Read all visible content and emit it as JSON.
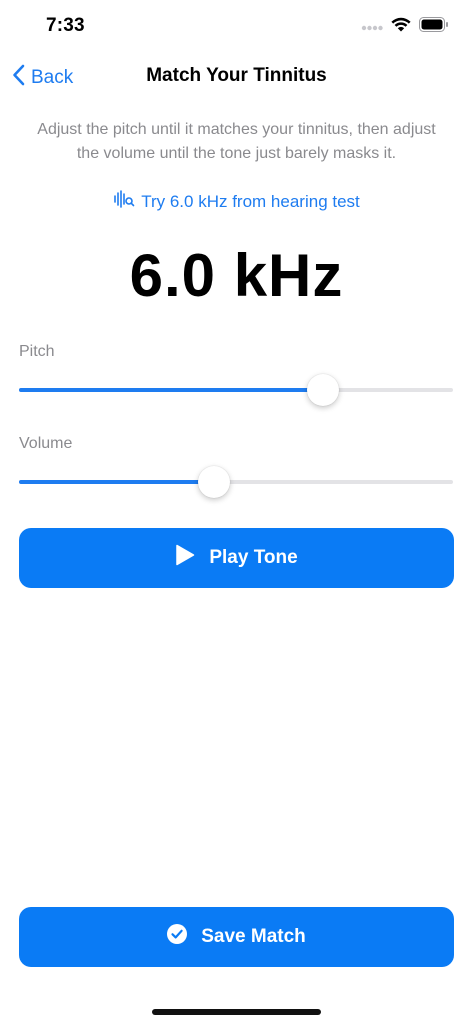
{
  "status_bar": {
    "time": "7:33",
    "icons": [
      "signal-dots-icon",
      "wifi-icon",
      "battery-icon"
    ]
  },
  "nav": {
    "back_label": "Back",
    "title": "Match Your Tinnitus"
  },
  "instructions": "Adjust the pitch until it matches your tinnitus, then adjust the volume until the tone just barely masks it.",
  "suggestion": {
    "icon": "hearing-waveform-icon",
    "label": "Try 6.0 kHz from hearing test"
  },
  "frequency_display": "6.0 kHz",
  "pitch": {
    "label": "Pitch",
    "value_fraction": 0.7
  },
  "volume": {
    "label": "Volume",
    "value_fraction": 0.45
  },
  "play_button": {
    "label": "Play Tone",
    "icon": "play-icon"
  },
  "save_button": {
    "label": "Save Match",
    "icon": "checkmark-circle-icon"
  },
  "colors": {
    "accent": "#0a7bf5",
    "link": "#1e7cf0",
    "secondary_text": "#8a8a8e",
    "track": "#e3e3e6"
  }
}
